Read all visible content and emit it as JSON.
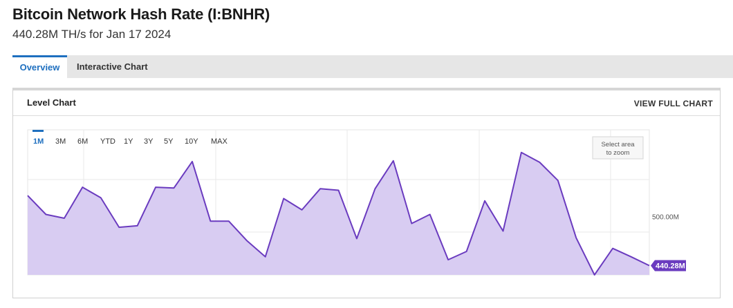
{
  "header": {
    "title": "Bitcoin Network Hash Rate (I:BNHR)",
    "subtitle": "440.28M TH/s for Jan 17 2024"
  },
  "tabs": [
    {
      "label": "Overview",
      "active": true
    },
    {
      "label": "Interactive Chart",
      "active": false
    }
  ],
  "panel": {
    "title": "Level Chart",
    "view_full": "VIEW FULL CHART"
  },
  "ranges": {
    "items": [
      "1M",
      "3M",
      "6M",
      "YTD",
      "1Y",
      "3Y",
      "5Y",
      "10Y",
      "MAX"
    ],
    "selected": "1M"
  },
  "zoom_hint": [
    "Select area",
    "to zoom"
  ],
  "colors": {
    "accent": "#1e6fbf",
    "line": "#6a3bbf",
    "fill": "#d8ccf2",
    "badge": "#6a3bbf"
  },
  "chart_data": {
    "type": "area",
    "x_count": 33,
    "values": [
      533,
      508,
      503,
      544,
      530,
      491,
      493,
      544,
      543,
      578,
      499,
      499,
      473,
      452,
      529,
      514,
      542,
      540,
      476,
      542,
      579,
      496,
      508,
      448,
      459,
      526,
      486,
      590,
      577,
      553,
      477,
      428,
      463,
      452,
      440.28
    ],
    "y_tick_labels": [
      {
        "value": 500,
        "label": "500.00M"
      }
    ],
    "ylim": [
      428,
      620
    ],
    "grid": true,
    "last_value_label": "440.28M"
  }
}
